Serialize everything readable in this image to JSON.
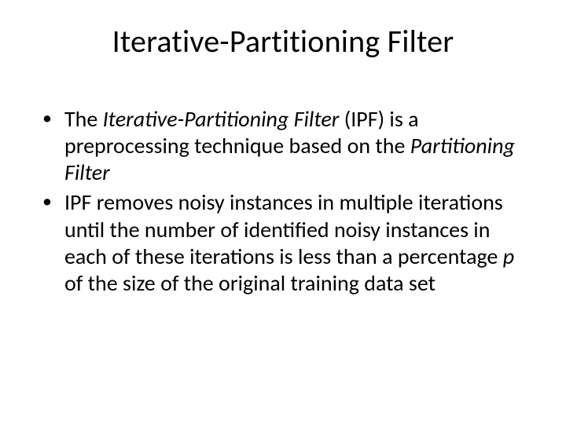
{
  "title": "Iterative-Partitioning Filter",
  "bullets": {
    "b1": {
      "t1": "The ",
      "i1": "Iterative-Partitioning Filter ",
      "t2": "(IPF) is a preprocessing technique based on the ",
      "i2": "Partitioning Filter"
    },
    "b2": {
      "t1": "IPF removes noisy instances in multiple iterations until the number of identified noisy instances in each of these iterations is less than a percentage ",
      "i1": "p",
      "t2": " of the size of the original training data set"
    }
  }
}
